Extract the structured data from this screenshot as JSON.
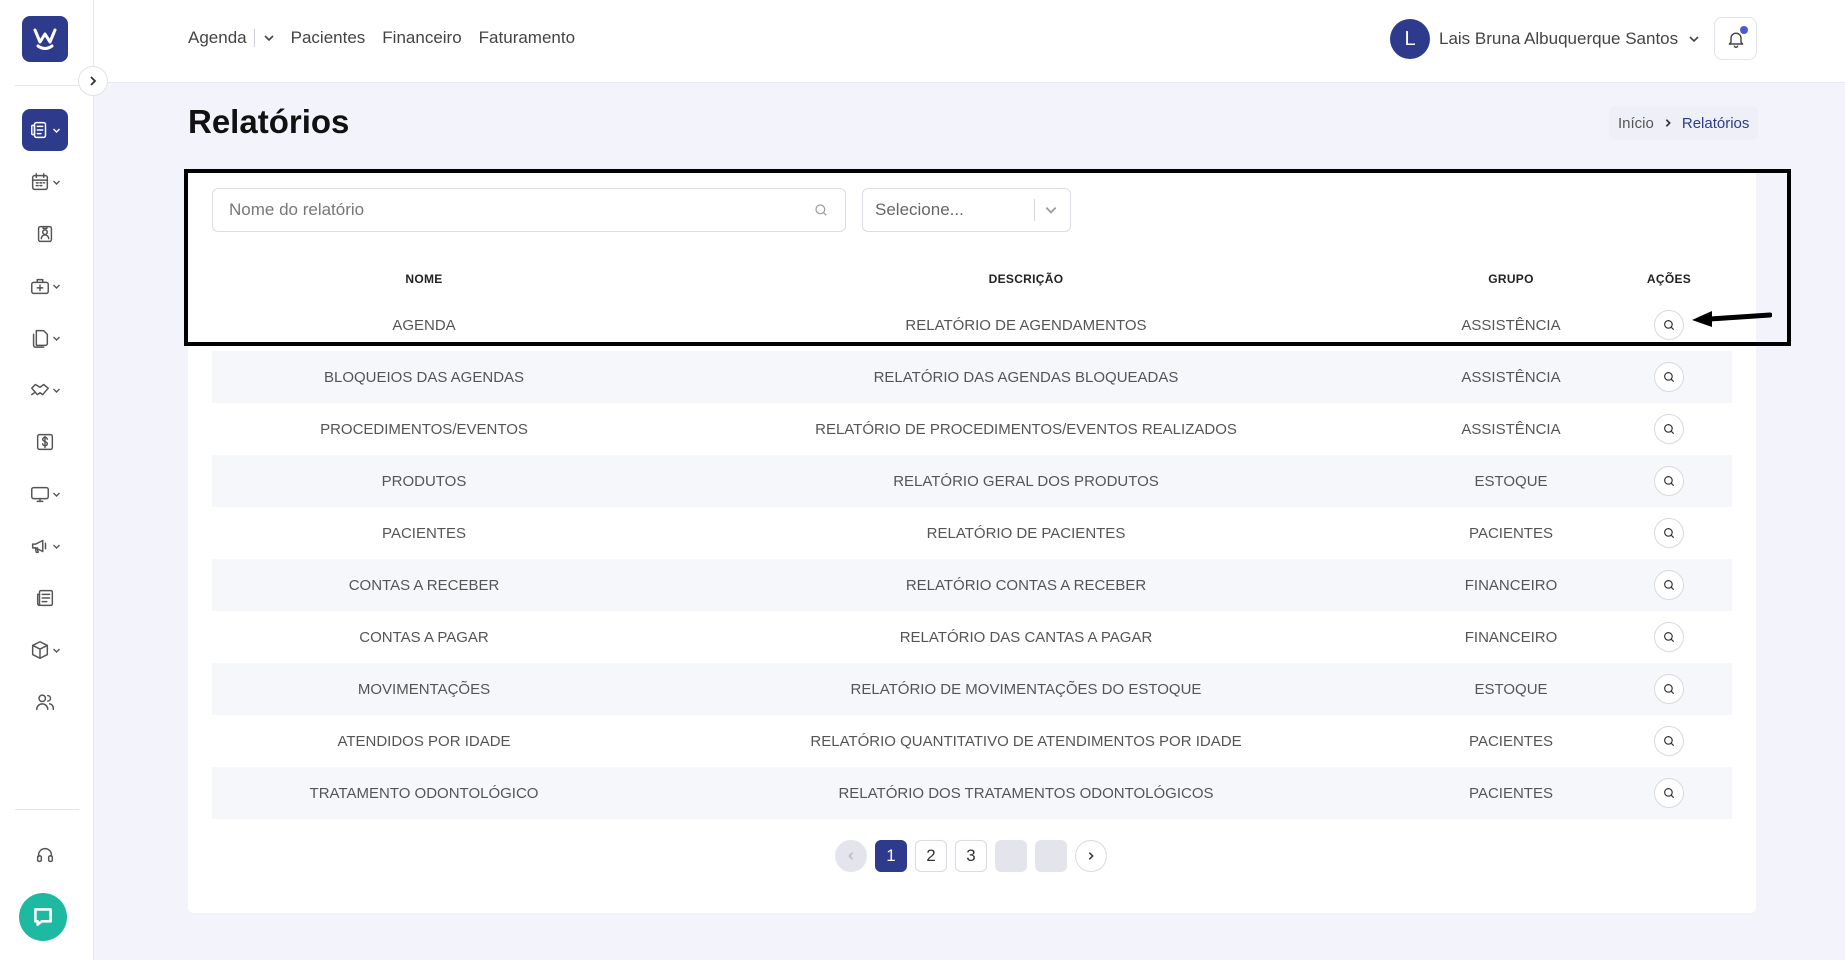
{
  "sidebar": {
    "logo_icon": "w-smile-logo-icon",
    "items": [
      {
        "name": "reports-icon",
        "active": true,
        "caret": true
      },
      {
        "name": "calendar-icon",
        "active": false,
        "caret": true
      },
      {
        "name": "patient-badge-icon",
        "active": false,
        "caret": false
      },
      {
        "name": "medical-bag-icon",
        "active": false,
        "caret": true
      },
      {
        "name": "documents-icon",
        "active": false,
        "caret": true
      },
      {
        "name": "handshake-icon",
        "active": false,
        "caret": true
      },
      {
        "name": "dollar-icon",
        "active": false,
        "caret": false
      },
      {
        "name": "monitor-icon",
        "active": false,
        "caret": true
      },
      {
        "name": "megaphone-icon",
        "active": false,
        "caret": true
      },
      {
        "name": "newspaper-icon",
        "active": false,
        "caret": false
      },
      {
        "name": "box-icon",
        "active": false,
        "caret": true
      },
      {
        "name": "users-icon",
        "active": false,
        "caret": false
      }
    ],
    "support_icon": "headset-icon",
    "chat_icon": "chat-bubble-icon"
  },
  "topnav": {
    "agenda": "Agenda",
    "pacientes": "Pacientes",
    "financeiro": "Financeiro",
    "faturamento": "Faturamento"
  },
  "user": {
    "initial": "L",
    "name": "Lais Bruna Albuquerque Santos"
  },
  "page": {
    "title": "Relatórios",
    "breadcrumb_home": "Início",
    "breadcrumb_current": "Relatórios"
  },
  "filters": {
    "search_placeholder": "Nome do relatório",
    "search_value": "",
    "select_value": "Selecione..."
  },
  "table": {
    "headers": {
      "nome": "NOME",
      "descricao": "DESCRIÇÃO",
      "grupo": "GRUPO",
      "acoes": "AÇÕES"
    },
    "rows": [
      {
        "nome": "AGENDA",
        "descricao": "RELATÓRIO DE AGENDAMENTOS",
        "grupo": "ASSISTÊNCIA"
      },
      {
        "nome": "BLOQUEIOS DAS AGENDAS",
        "descricao": "RELATÓRIO DAS AGENDAS BLOQUEADAS",
        "grupo": "ASSISTÊNCIA"
      },
      {
        "nome": "PROCEDIMENTOS/EVENTOS",
        "descricao": "RELATÓRIO DE PROCEDIMENTOS/EVENTOS REALIZADOS",
        "grupo": "ASSISTÊNCIA"
      },
      {
        "nome": "PRODUTOS",
        "descricao": "RELATÓRIO GERAL DOS PRODUTOS",
        "grupo": "ESTOQUE"
      },
      {
        "nome": "PACIENTES",
        "descricao": "RELATÓRIO DE PACIENTES",
        "grupo": "PACIENTES"
      },
      {
        "nome": "CONTAS A RECEBER",
        "descricao": "RELATÓRIO CONTAS A RECEBER",
        "grupo": "FINANCEIRO"
      },
      {
        "nome": "CONTAS A PAGAR",
        "descricao": "RELATÓRIO DAS CANTAS A PAGAR",
        "grupo": "FINANCEIRO"
      },
      {
        "nome": "MOVIMENTAÇÕES",
        "descricao": "RELATÓRIO DE MOVIMENTAÇÕES DO ESTOQUE",
        "grupo": "ESTOQUE"
      },
      {
        "nome": "ATENDIDOS POR IDADE",
        "descricao": "RELATÓRIO QUANTITATIVO DE ATENDIMENTOS POR IDADE",
        "grupo": "PACIENTES"
      },
      {
        "nome": "TRATAMENTO ODONTOLÓGICO",
        "descricao": "RELATÓRIO DOS TRATAMENTOS ODONTOLÓGICOS",
        "grupo": "PACIENTES"
      }
    ]
  },
  "pagination": {
    "pages": [
      "1",
      "2",
      "3"
    ],
    "current": "1"
  },
  "colors": {
    "primary": "#2e3a8c",
    "accent_chat": "#1db9a0",
    "notification_dot": "#4b57d6",
    "background": "#f3f4fb"
  }
}
